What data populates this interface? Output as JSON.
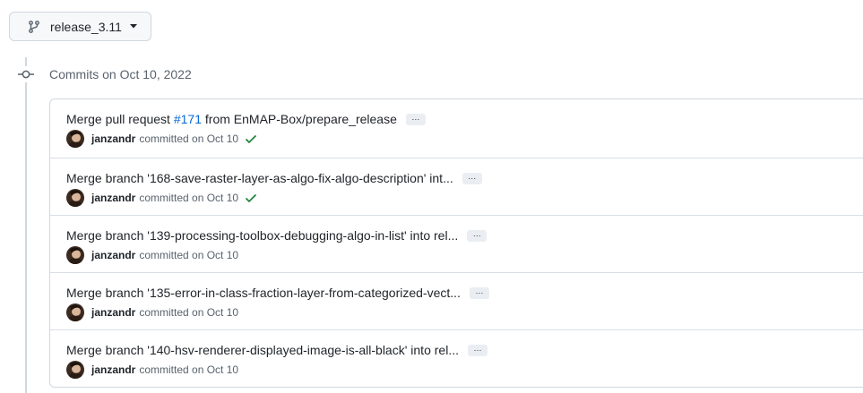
{
  "branch": {
    "name": "release_3.11",
    "icon": "git-branch-icon"
  },
  "timeline": {
    "header": "Commits on Oct 10, 2022",
    "icon": "git-commit-icon"
  },
  "commits": [
    {
      "title_prefix": "Merge pull request ",
      "pr_link": "#171",
      "title_suffix": " from EnMAP-Box/prepare_release",
      "ellipsis": "···",
      "author": "janzandr",
      "committed": "committed on Oct 10",
      "verified": true
    },
    {
      "title_prefix": "Merge branch '168-save-raster-layer-as-algo-fix-algo-description' int...",
      "pr_link": "",
      "title_suffix": "",
      "ellipsis": "···",
      "author": "janzandr",
      "committed": "committed on Oct 10",
      "verified": true
    },
    {
      "title_prefix": "Merge branch '139-processing-toolbox-debugging-algo-in-list' into rel...",
      "pr_link": "",
      "title_suffix": "",
      "ellipsis": "···",
      "author": "janzandr",
      "committed": "committed on Oct 10",
      "verified": false
    },
    {
      "title_prefix": "Merge branch '135-error-in-class-fraction-layer-from-categorized-vect...",
      "pr_link": "",
      "title_suffix": "",
      "ellipsis": "···",
      "author": "janzandr",
      "committed": "committed on Oct 10",
      "verified": false
    },
    {
      "title_prefix": "Merge branch '140-hsv-renderer-displayed-image-is-all-black' into rel...",
      "pr_link": "",
      "title_suffix": "",
      "ellipsis": "···",
      "author": "janzandr",
      "committed": "committed on Oct 10",
      "verified": false
    }
  ],
  "colors": {
    "link": "#0969da",
    "success": "#1a7f37",
    "muted": "#59636e",
    "border": "#d0d7de"
  }
}
